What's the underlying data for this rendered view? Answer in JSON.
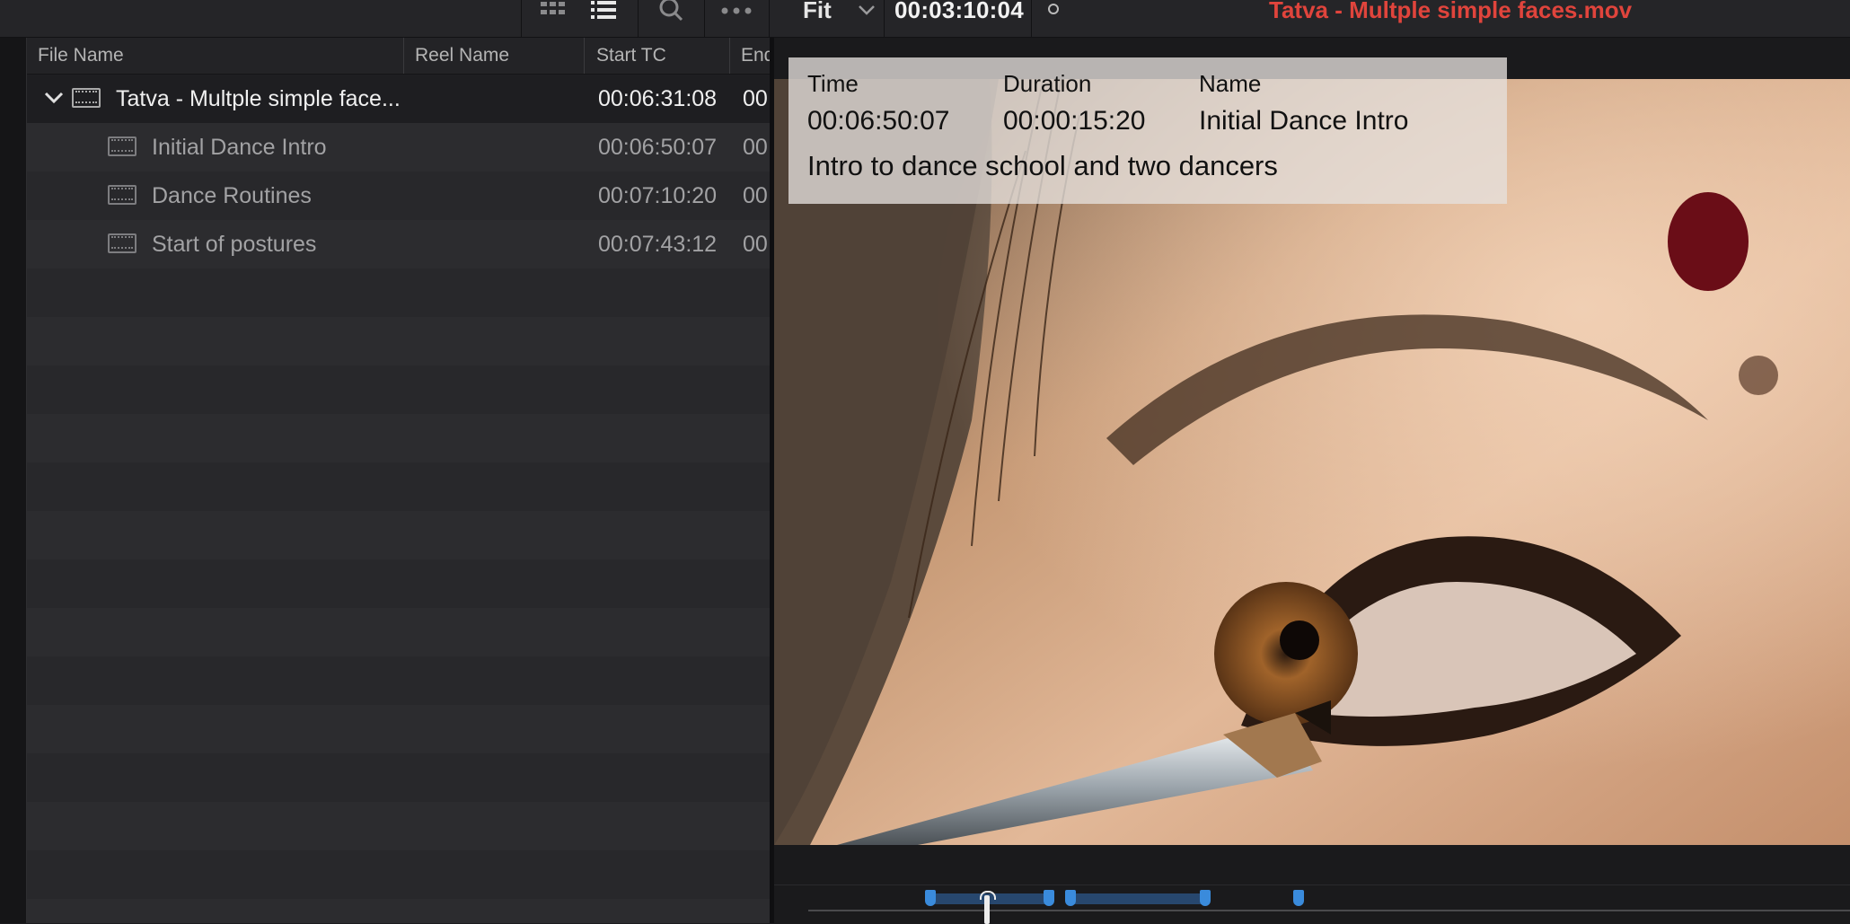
{
  "toolbar": {
    "fit_label": "Fit",
    "timecode": "00:03:10:04",
    "clip_title": "Tatva - Multple simple faces.mov",
    "icons": [
      "grid-view-icon",
      "list-view-icon",
      "search-icon",
      "more-options-icon",
      "chevron-down-icon"
    ]
  },
  "media_pool": {
    "columns": [
      "File Name",
      "Reel Name",
      "Start TC",
      "End"
    ],
    "parent": {
      "name": "Tatva - Multple simple face...",
      "start_tc": "00:06:31:08",
      "end_tc": "00"
    },
    "children": [
      {
        "name": "Initial Dance Intro",
        "start_tc": "00:06:50:07",
        "end_tc": "00"
      },
      {
        "name": "Dance Routines",
        "start_tc": "00:07:10:20",
        "end_tc": "00"
      },
      {
        "name": "Start of postures",
        "start_tc": "00:07:43:12",
        "end_tc": "00"
      }
    ]
  },
  "overlay": {
    "time_label": "Time",
    "duration_label": "Duration",
    "name_label": "Name",
    "time_value": "00:06:50:07",
    "duration_value": "00:00:15:20",
    "name_value": "Initial Dance Intro",
    "description": "Intro to dance school and two dancers"
  },
  "colors": {
    "title_red": "#e0443c",
    "marker_blue": "#3a8bdc"
  }
}
